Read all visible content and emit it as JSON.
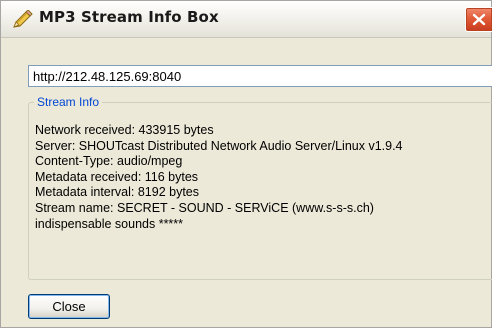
{
  "window": {
    "title": "MP3 Stream Info Box",
    "title_icon": "pencil-edit-icon",
    "close_icon": "close-x-icon"
  },
  "url_field": {
    "value": "http://212.48.125.69:8040"
  },
  "stream_info": {
    "legend": "Stream Info",
    "lines": [
      "Network received: 433915 bytes",
      "Server: SHOUTcast Distributed Network Audio Server/Linux v1.9.4",
      "Content-Type: audio/mpeg",
      "Metadata received: 116 bytes",
      "Metadata interval: 8192 bytes",
      "Stream name: SECRET - SOUND - SERViCE (www.s-s-s.ch)",
      "indispensable sounds *****"
    ]
  },
  "buttons": {
    "close_label": "Close"
  },
  "colors": {
    "dialog_bg": "#ece9d8",
    "legend_text": "#0046d5",
    "close_x": "#e25b38",
    "input_border": "#7f9db9"
  }
}
